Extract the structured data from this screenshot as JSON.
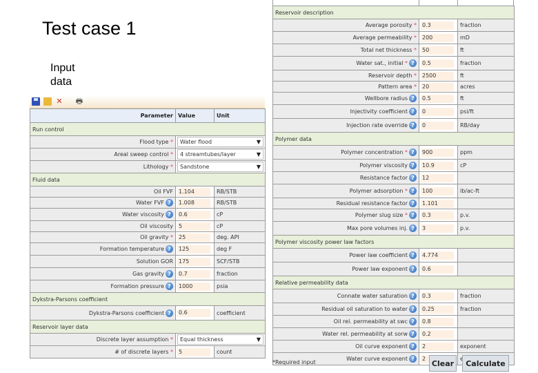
{
  "slide": {
    "title": "Test case 1",
    "subtitle": "Input data"
  },
  "toolbar": {
    "icons": [
      "save-icon",
      "open-icon",
      "delete-icon",
      "print-icon"
    ]
  },
  "table_header": {
    "parameter": "Parameter",
    "value": "Value",
    "unit": "Unit"
  },
  "left": {
    "sections": {
      "run_control": "Run control",
      "fluid_data": "Fluid data",
      "dykstra": "Dykstra-Parsons coefficient",
      "reservoir_layer": "Reservoir layer data"
    },
    "flood_type": {
      "label": "Flood type",
      "value": "Water flood"
    },
    "areal_sweep": {
      "label": "Areal sweep control",
      "value": "4 streamtubes/layer"
    },
    "lithology": {
      "label": "Lithology",
      "value": "Sandstone"
    },
    "oil_fvf": {
      "label": "Oil FVF",
      "value": "1.104",
      "unit": "RB/STB"
    },
    "water_fvf": {
      "label": "Water FVF",
      "value": "1.008",
      "unit": "RB/STB"
    },
    "water_visc": {
      "label": "Water viscosity",
      "value": "0.6",
      "unit": "cP"
    },
    "oil_visc": {
      "label": "Oil viscosity",
      "value": "5",
      "unit": "cP"
    },
    "oil_gravity": {
      "label": "Oil gravity",
      "value": "25",
      "unit": "deg. API"
    },
    "form_temp": {
      "label": "Formation temperature",
      "value": "125",
      "unit": "deg F"
    },
    "sol_gor": {
      "label": "Solution GOR",
      "value": "175",
      "unit": "SCF/STB"
    },
    "gas_gravity": {
      "label": "Gas gravity",
      "value": "0.7",
      "unit": "fraction"
    },
    "form_press": {
      "label": "Formation pressure",
      "value": "1000",
      "unit": "psia"
    },
    "dp_coef": {
      "label": "Dykstra-Parsons coefficient",
      "value": "0.6",
      "unit": "coefficient"
    },
    "layer_assump": {
      "label": "Discrete layer assumption",
      "value": "Equal thickness"
    },
    "num_layers": {
      "label": "# of discrete layers",
      "value": "5",
      "unit": "count"
    }
  },
  "right": {
    "sections": {
      "reservoir_desc": "Reservoir description",
      "polymer_data": "Polymer data",
      "power_law": "Polymer viscosity power law factors",
      "relperm": "Relative permeability data"
    },
    "porosity": {
      "label": "Average porosity",
      "value": "0.3",
      "unit": "fraction"
    },
    "permeability": {
      "label": "Average permeability",
      "value": "200",
      "unit": "mD"
    },
    "net_thickness": {
      "label": "Total net thickness",
      "value": "50",
      "unit": "ft"
    },
    "water_sat_init": {
      "label": "Water sat., initial",
      "value": "0.5",
      "unit": "fraction"
    },
    "res_depth": {
      "label": "Reservoir depth",
      "value": "2500",
      "unit": "ft"
    },
    "pattern_area": {
      "label": "Pattern area",
      "value": "20",
      "unit": "acres"
    },
    "wellbore_radius": {
      "label": "Wellbore radius",
      "value": "0.5",
      "unit": "ft"
    },
    "injectivity": {
      "label": "Injectivity coefficient",
      "value": "0",
      "unit": "psi/ft"
    },
    "inj_override": {
      "label": "Injection rate override",
      "value": "0",
      "unit": "RB/day"
    },
    "poly_conc": {
      "label": "Polymer concentration",
      "value": "900",
      "unit": "ppm"
    },
    "poly_visc": {
      "label": "Polymer viscosity",
      "value": "10.9",
      "unit": "cP"
    },
    "resist_factor": {
      "label": "Resistance factor",
      "value": "12",
      "unit": ""
    },
    "poly_adsorp": {
      "label": "Polymer adsorption",
      "value": "100",
      "unit": "lb/ac-ft"
    },
    "resid_resist": {
      "label": "Residual resistance factor",
      "value": "1.101",
      "unit": ""
    },
    "slug_size": {
      "label": "Polymer slug size",
      "value": "0.3",
      "unit": "p.v."
    },
    "max_pv": {
      "label": "Max pore volumes inj.",
      "value": "3",
      "unit": "p.v."
    },
    "pl_coef": {
      "label": "Power law coefficient",
      "value": "4.774",
      "unit": ""
    },
    "pl_exp": {
      "label": "Power law exponent",
      "value": "0.6",
      "unit": ""
    },
    "connate_sw": {
      "label": "Connate water saturation",
      "value": "0.3",
      "unit": "fraction"
    },
    "resid_oil": {
      "label": "Residual oil saturation to water",
      "value": "0.25",
      "unit": "fraction"
    },
    "oil_relperm": {
      "label": "Oil rel. permeability at swc",
      "value": "0.8",
      "unit": ""
    },
    "water_relperm": {
      "label": "Water rel. permeability at sorw",
      "value": "0.2",
      "unit": ""
    },
    "oil_exp": {
      "label": "Oil curve exponent",
      "value": "2",
      "unit": "exponent"
    },
    "water_exp": {
      "label": "Water curve exponent",
      "value": "2",
      "unit": "exponent"
    }
  },
  "footer": {
    "required_note": "*Required input",
    "clear_label": "Clear",
    "calculate_label": "Calculate"
  }
}
